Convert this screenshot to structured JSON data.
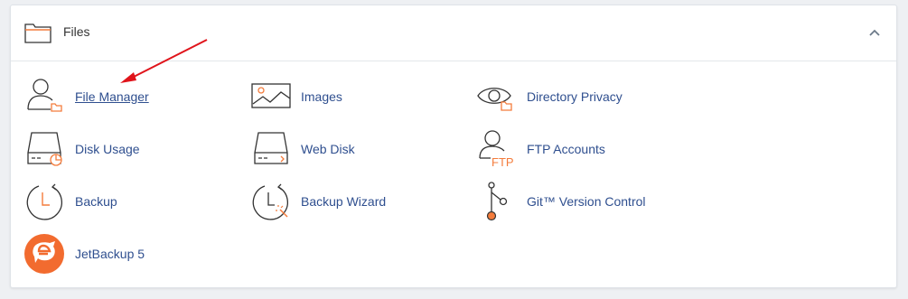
{
  "section": {
    "title": "Files",
    "collapse_icon": "chevron-up-icon"
  },
  "items": [
    {
      "label": "File Manager",
      "icon": "file-manager-icon"
    },
    {
      "label": "Images",
      "icon": "images-icon"
    },
    {
      "label": "Directory Privacy",
      "icon": "eye-folder-icon"
    },
    {
      "label": "Disk Usage",
      "icon": "disk-usage-icon"
    },
    {
      "label": "Web Disk",
      "icon": "web-disk-icon"
    },
    {
      "label": "FTP Accounts",
      "icon": "ftp-accounts-icon"
    },
    {
      "label": "Backup",
      "icon": "backup-clock-icon"
    },
    {
      "label": "Backup Wizard",
      "icon": "backup-wizard-icon"
    },
    {
      "label": "Git™ Version Control",
      "icon": "git-branch-icon"
    },
    {
      "label": "JetBackup 5",
      "icon": "jetbackup-logo-icon"
    }
  ],
  "icon_text": {
    "ftp": "FTP"
  },
  "colors": {
    "accent": "#f47c3c",
    "link": "#2f4f8f",
    "annotation_arrow": "#e0141b"
  }
}
